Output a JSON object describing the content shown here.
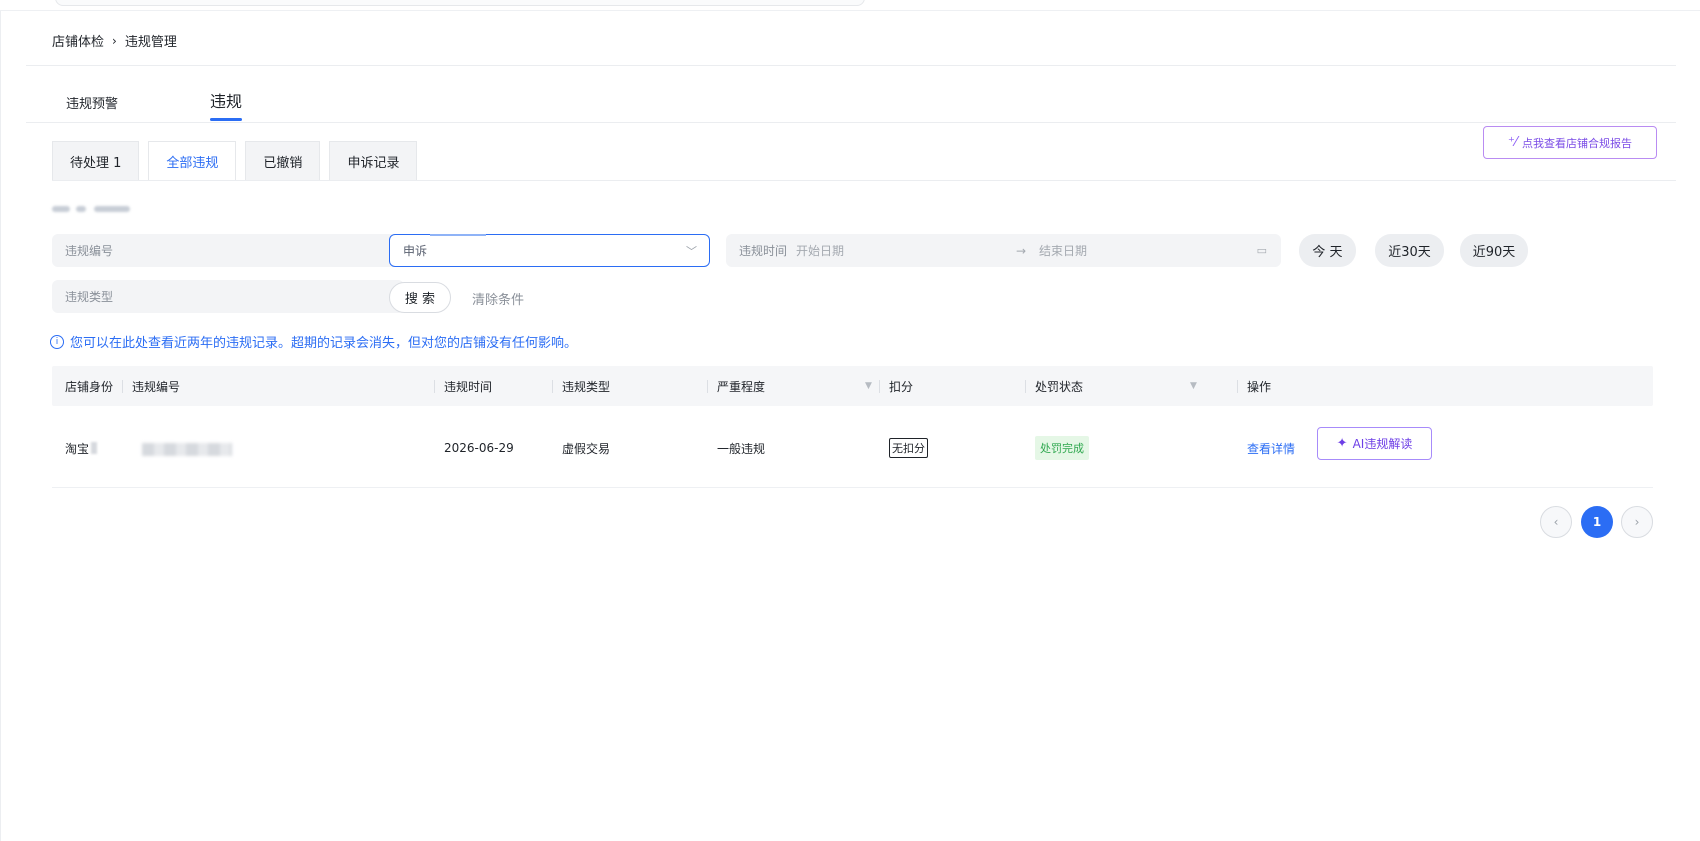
{
  "breadcrumb": {
    "root": "店铺体检",
    "separator": "›",
    "current": "违规管理"
  },
  "main_tabs": [
    {
      "label": "违规预警"
    },
    {
      "label": "违规"
    }
  ],
  "sub_tabs": [
    {
      "label": "待处理 1"
    },
    {
      "label": "全部违规"
    },
    {
      "label": "已撤销"
    },
    {
      "label": "申诉记录"
    }
  ],
  "report_button": {
    "label": "点我查看店铺合规报告",
    "icon": "magic-wand-icon"
  },
  "filters": {
    "violation_no_placeholder": "违规编号",
    "violation_type_placeholder": "违规类型",
    "appeal_select_value": "申诉",
    "date_label": "违规时间",
    "start_placeholder": "开始日期",
    "end_placeholder": "结束日期",
    "quick_today": "今 天",
    "quick_30": "近30天",
    "quick_90": "近90天",
    "search_label": "搜 索",
    "clear_label": "清除条件"
  },
  "notice": "您可以在此处查看近两年的违规记录。超期的记录会消失，但对您的店铺没有任何影响。",
  "table": {
    "headers": [
      "店铺身份",
      "违规编号",
      "违规时间",
      "违规类型",
      "严重程度",
      "扣分",
      "处罚状态",
      "操作"
    ],
    "rows": [
      {
        "shop": "淘宝",
        "violation_no": "",
        "time": "2026-06-29",
        "type": "虚假交易",
        "severity": "一般违规",
        "deduction": "无扣分",
        "status": "处罚完成",
        "action_detail": "查看详情",
        "action_ai": "AI违规解读"
      }
    ]
  },
  "pagination": {
    "current": "1",
    "prev_icon": "chevron-left-icon",
    "next_icon": "chevron-right-icon"
  },
  "colors": {
    "accent": "#2b6df4",
    "ai_purple": "#6d3fe6",
    "success": "#2fa84f"
  }
}
